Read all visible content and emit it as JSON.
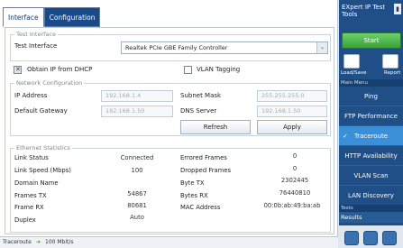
{
  "tabs": [
    {
      "label": "Interface"
    },
    {
      "label": "Configuration"
    }
  ],
  "test_interface": {
    "group_title": "Test Interface",
    "label": "Test Interface",
    "selected": "Realtek PCIe GBE Family Controller"
  },
  "dhcp": {
    "label": "Obtain IP from DHCP",
    "checked": true
  },
  "vlan": {
    "label": "VLAN Tagging",
    "checked": false
  },
  "network": {
    "group_title": "Network Configuration",
    "ip_label": "IP Address",
    "ip_value": "192.168.1.4",
    "mask_label": "Subnet Mask",
    "mask_value": "255.255.255.0",
    "gateway_label": "Default Gateway",
    "gateway_value": "192.168.1.50",
    "dns_label": "DNS Server",
    "dns_value": "192.168.1.50",
    "refresh_label": "Refresh",
    "apply_label": "Apply"
  },
  "ethernet": {
    "group_title": "Ethernet Statistics",
    "left": [
      {
        "label": "Link Status",
        "value": "Connected"
      },
      {
        "label": "Link Speed (Mbps)",
        "value": "100"
      },
      {
        "label": "Domain Name",
        "value": ""
      },
      {
        "label": "Frames TX",
        "value": "54867"
      },
      {
        "label": "Frame RX",
        "value": "80681"
      },
      {
        "label": "Duplex",
        "value": "Auto"
      }
    ],
    "right": [
      {
        "label": "Errored Frames",
        "value": "0"
      },
      {
        "label": "Dropped Frames",
        "value": "0"
      },
      {
        "label": "Byte TX",
        "value": "2302445"
      },
      {
        "label": "Bytes RX",
        "value": "76440810"
      },
      {
        "label": "MAC Address",
        "value": "00:0b:ab:49:ba:ab"
      }
    ]
  },
  "statusbar": {
    "left": "Traceroute",
    "right": "100 Mbit/s"
  },
  "side": {
    "title": "EXpert IP Test Tools",
    "start_label": "Start",
    "load_save_label": "Load/Save",
    "report_label": "Report",
    "main_menu_label": "Main Menu",
    "menu": [
      {
        "label": "Ping"
      },
      {
        "label": "FTP Performance"
      },
      {
        "label": "Traceroute"
      },
      {
        "label": "HTTP Availability"
      },
      {
        "label": "VLAN Scan"
      },
      {
        "label": "LAN Discovery"
      }
    ],
    "tests_label": "Tests",
    "results_label": "Results"
  }
}
